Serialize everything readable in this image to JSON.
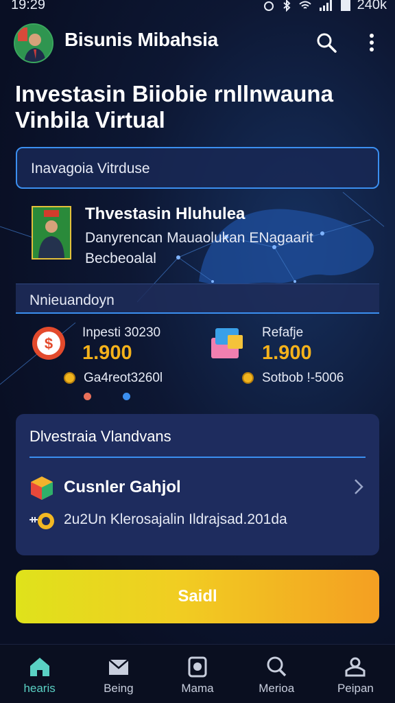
{
  "status_bar": {
    "time": "19:29",
    "battery": "240k"
  },
  "header": {
    "app_title": "Bisunis Mibahsia"
  },
  "page": {
    "title": "Investasin Biiobie rnllnwauna Vinbila Virtual"
  },
  "search": {
    "value": "Inavagoia Vitrduse"
  },
  "feature": {
    "title": "Thvestasin Hluhulea",
    "description": "Danyrencan Mauaolukan ENagaarit Becbeoalal"
  },
  "section": {
    "label": "Nnieuandoyn"
  },
  "stats": [
    {
      "label": "Inpesti 30230",
      "value": "1.900",
      "sub": "Ga4reot3260l",
      "dot_color": "#e9705a"
    },
    {
      "label": "Refafje",
      "value": "1.900",
      "sub": "Sotbob !-5006",
      "dot_color": "#3b8ff0"
    }
  ],
  "card": {
    "title": "Dlvestraia Vlandvans",
    "row_title": "Cusnler Gahjol",
    "footer": "2u2Un Klerosajalin Ildrajsad.201da"
  },
  "cta": {
    "label": "Saidl"
  },
  "bottom_nav": [
    {
      "label": "hearis",
      "icon": "home-icon"
    },
    {
      "label": "Being",
      "icon": "mail-icon"
    },
    {
      "label": "Mama",
      "icon": "camera-icon"
    },
    {
      "label": "Merioa",
      "icon": "search-icon"
    },
    {
      "label": "Peipan",
      "icon": "profile-icon"
    }
  ],
  "colors": {
    "accent": "#3b8ff0",
    "value": "#f5b21b",
    "active_nav": "#5ad1c4"
  }
}
